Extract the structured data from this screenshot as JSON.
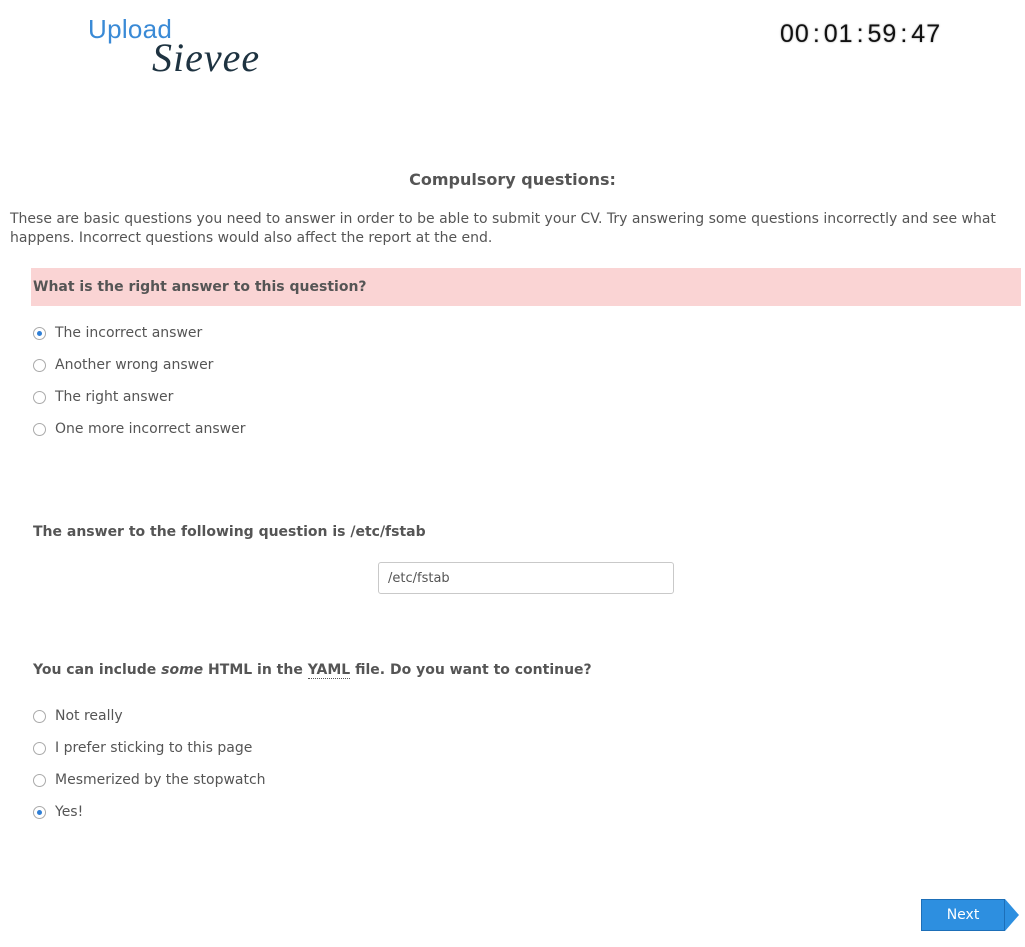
{
  "header": {
    "logo_upload": "Upload",
    "logo_sievee": "Sievee",
    "timer": {
      "hours": "00",
      "minutes": "01",
      "seconds": "59",
      "centis": "47"
    }
  },
  "page": {
    "heading": "Compulsory questions:",
    "intro": "These are basic questions you need to answer in order to be able to submit your CV. Try answering some questions incorrectly and see what happens. Incorrect questions would also affect the report at the end."
  },
  "q1": {
    "title": "What is the right answer to this question?",
    "options": [
      "The incorrect answer",
      "Another wrong answer",
      "The right answer",
      "One more incorrect answer"
    ],
    "selected": 0
  },
  "q2": {
    "title": "The answer to the following question is /etc/fstab",
    "value": "/etc/fstab"
  },
  "q3": {
    "title_pre": "You can include ",
    "title_em": "some",
    "title_mid": " HTML in the ",
    "title_abbr": "YAML",
    "title_post": " file. Do you want to continue?",
    "options": [
      "Not really",
      "I prefer sticking to this page",
      "Mesmerized by the stopwatch",
      "Yes!"
    ],
    "selected": 3
  },
  "nav": {
    "next_label": "Next"
  },
  "colors": {
    "accent": "#2d8fe0",
    "error_bg": "#fad4d4"
  }
}
